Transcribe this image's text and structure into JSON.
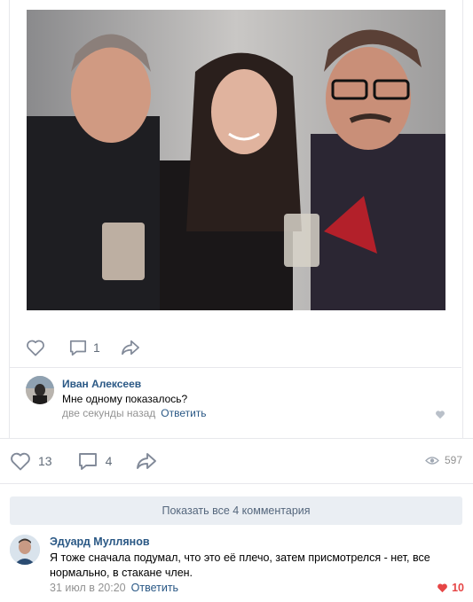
{
  "post": {
    "photo_alt": "photo",
    "inner_actions": {
      "likes": "",
      "comments": "1",
      "share": ""
    },
    "comment": {
      "author": "Иван Алексеев",
      "text": "Мне одному показалось?",
      "time": "две секунды назад",
      "reply_label": "Ответить"
    },
    "outer_actions": {
      "likes": "13",
      "comments": "4",
      "views": "597"
    },
    "show_all_label": "Показать все 4 комментария",
    "top_comment": {
      "author": "Эдуард Муллянов",
      "text": "Я тоже сначала подумал, что это её плечо, затем присмотрелся - нет, все нормально, в стакане член.",
      "time": "31 июл в 20:20",
      "reply_label": "Ответить",
      "likes": "10"
    }
  },
  "colors": {
    "link": "#2a5885",
    "muted": "#939393",
    "like_active": "#e64646",
    "button_bg": "#eaeef3"
  },
  "icons": [
    "heart-icon",
    "comment-icon",
    "share-icon",
    "eye-icon"
  ]
}
